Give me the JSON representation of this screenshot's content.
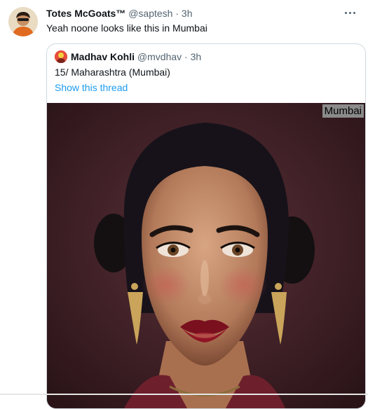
{
  "tweet": {
    "name": "Totes McGoats™",
    "handle": "@saptesh",
    "separator": "·",
    "time": "3h",
    "text": "Yeah noone looks like this in Mumbai",
    "avatar_icon": "user-avatar",
    "more_icon": "more-horizontal-icon"
  },
  "quote": {
    "name": "Madhav Kohli",
    "handle": "@mvdhav",
    "separator": "·",
    "time": "3h",
    "text": "15/ Maharashtra (Mumbai)",
    "link": "Show this thread",
    "image_caption": "Mumbai"
  },
  "colors": {
    "link": "#1d9bf0",
    "secondary_text": "#536471",
    "border": "#cfd9de"
  }
}
